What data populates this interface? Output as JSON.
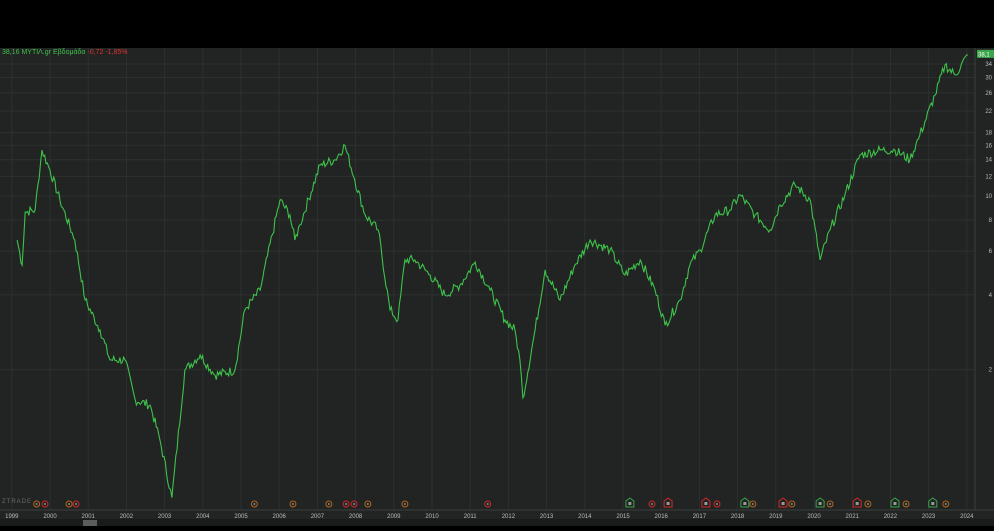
{
  "legend": {
    "symbol_text": "38,16 ΜΥΤΙΛ.gr Εβδομάδα",
    "change_text": "-0,72 -1,85%"
  },
  "last_price_label": "38,1",
  "brand": "ZTRADE",
  "colors": {
    "line": "#3ec24a",
    "bg": "#212423",
    "grid": "#2c302f",
    "green": "#3aa54a",
    "red": "#d02828",
    "orange": "#b5651d"
  },
  "chart_data": {
    "type": "line",
    "title": "ΜΥΤΙΛ.gr Εβδομάδα",
    "yscale": "log",
    "ylim": [
      0.55,
      40
    ],
    "xlim": [
      1998.9,
      2024.3
    ],
    "x_ticks": [
      "1999",
      "2000",
      "2001",
      "2002",
      "2003",
      "2004",
      "2005",
      "2006",
      "2007",
      "2008",
      "2009",
      "2010",
      "2011",
      "2012",
      "2013",
      "2014",
      "2015",
      "2016",
      "2017",
      "2018",
      "2019",
      "2020",
      "2021",
      "2022",
      "2023",
      "2024"
    ],
    "y_ticks": [
      34,
      30,
      26,
      22,
      18,
      16,
      14,
      12,
      10,
      8,
      6,
      4,
      2
    ],
    "series": [
      {
        "name": "ΜΥΤΙΛ.gr",
        "points": [
          [
            1999.14,
            6.65
          ],
          [
            1999.27,
            5.27
          ],
          [
            1999.35,
            8.62
          ],
          [
            1999.61,
            8.78
          ],
          [
            1999.79,
            15.3
          ],
          [
            2000.0,
            12.7
          ],
          [
            2000.26,
            9.63
          ],
          [
            2000.65,
            6.65
          ],
          [
            2000.92,
            3.81
          ],
          [
            2001.31,
            2.89
          ],
          [
            2001.57,
            2.19
          ],
          [
            2001.96,
            2.19
          ],
          [
            2002.23,
            1.51
          ],
          [
            2002.62,
            1.44
          ],
          [
            2002.88,
            1.04
          ],
          [
            2003.19,
            0.61
          ],
          [
            2003.53,
            1.99
          ],
          [
            2003.93,
            2.29
          ],
          [
            2004.32,
            1.9
          ],
          [
            2004.84,
            1.99
          ],
          [
            2005.1,
            3.48
          ],
          [
            2005.5,
            4.18
          ],
          [
            2006.02,
            9.63
          ],
          [
            2006.28,
            8.39
          ],
          [
            2006.41,
            6.65
          ],
          [
            2006.54,
            7.64
          ],
          [
            2007.07,
            13.3
          ],
          [
            2007.46,
            14.0
          ],
          [
            2007.72,
            16.0
          ],
          [
            2007.98,
            11.6
          ],
          [
            2008.25,
            8.39
          ],
          [
            2008.59,
            7.3
          ],
          [
            2008.9,
            3.48
          ],
          [
            2009.11,
            3.17
          ],
          [
            2009.29,
            5.53
          ],
          [
            2009.55,
            5.53
          ],
          [
            2009.95,
            4.81
          ],
          [
            2010.34,
            3.99
          ],
          [
            2010.73,
            4.38
          ],
          [
            2011.13,
            5.42
          ],
          [
            2011.52,
            4.18
          ],
          [
            2011.91,
            3.17
          ],
          [
            2012.17,
            2.89
          ],
          [
            2012.3,
            2.19
          ],
          [
            2012.38,
            1.54
          ],
          [
            2012.7,
            2.89
          ],
          [
            2012.96,
            5.04
          ],
          [
            2013.35,
            3.81
          ],
          [
            2013.74,
            5.27
          ],
          [
            2014.14,
            6.65
          ],
          [
            2014.66,
            6.06
          ],
          [
            2015.05,
            4.81
          ],
          [
            2015.45,
            5.53
          ],
          [
            2015.84,
            4.18
          ],
          [
            2016.1,
            3.02
          ],
          [
            2016.49,
            3.81
          ],
          [
            2016.75,
            5.27
          ],
          [
            2017.02,
            6.06
          ],
          [
            2017.41,
            8.39
          ],
          [
            2017.8,
            8.78
          ],
          [
            2018.06,
            10.1
          ],
          [
            2018.46,
            8.39
          ],
          [
            2018.85,
            7.3
          ],
          [
            2019.11,
            9.2
          ],
          [
            2019.5,
            11.1
          ],
          [
            2019.9,
            9.63
          ],
          [
            2020.16,
            5.53
          ],
          [
            2020.42,
            7.3
          ],
          [
            2020.81,
            10.1
          ],
          [
            2021.2,
            14.6
          ],
          [
            2021.73,
            15.3
          ],
          [
            2022.12,
            15.3
          ],
          [
            2022.51,
            14.0
          ],
          [
            2022.77,
            17.6
          ],
          [
            2023.17,
            25.5
          ],
          [
            2023.43,
            33.7
          ],
          [
            2023.69,
            30.7
          ],
          [
            2024.03,
            37.0
          ]
        ]
      }
    ],
    "events": [
      {
        "year": 1999.65,
        "type": "D"
      },
      {
        "year": 1999.87,
        "type": "R"
      },
      {
        "year": 2000.5,
        "type": "D"
      },
      {
        "year": 2000.68,
        "type": "R"
      },
      {
        "year": 2005.35,
        "type": "D"
      },
      {
        "year": 2006.36,
        "type": "D"
      },
      {
        "year": 2007.3,
        "type": "D"
      },
      {
        "year": 2007.75,
        "type": "R"
      },
      {
        "year": 2007.96,
        "type": "R"
      },
      {
        "year": 2008.32,
        "type": "D"
      },
      {
        "year": 2009.29,
        "type": "D"
      },
      {
        "year": 2011.46,
        "type": "R"
      },
      {
        "year": 2015.18,
        "type": "EG"
      },
      {
        "year": 2015.76,
        "type": "R"
      },
      {
        "year": 2016.18,
        "type": "ER"
      },
      {
        "year": 2017.17,
        "type": "ER"
      },
      {
        "year": 2017.46,
        "type": "R"
      },
      {
        "year": 2018.19,
        "type": "EG"
      },
      {
        "year": 2018.4,
        "type": "D"
      },
      {
        "year": 2019.19,
        "type": "ER"
      },
      {
        "year": 2019.42,
        "type": "D"
      },
      {
        "year": 2020.16,
        "type": "EG"
      },
      {
        "year": 2020.42,
        "type": "D"
      },
      {
        "year": 2021.13,
        "type": "ER"
      },
      {
        "year": 2021.41,
        "type": "D"
      },
      {
        "year": 2022.12,
        "type": "EG"
      },
      {
        "year": 2022.41,
        "type": "D"
      },
      {
        "year": 2023.11,
        "type": "EG"
      },
      {
        "year": 2023.45,
        "type": "D"
      }
    ]
  }
}
